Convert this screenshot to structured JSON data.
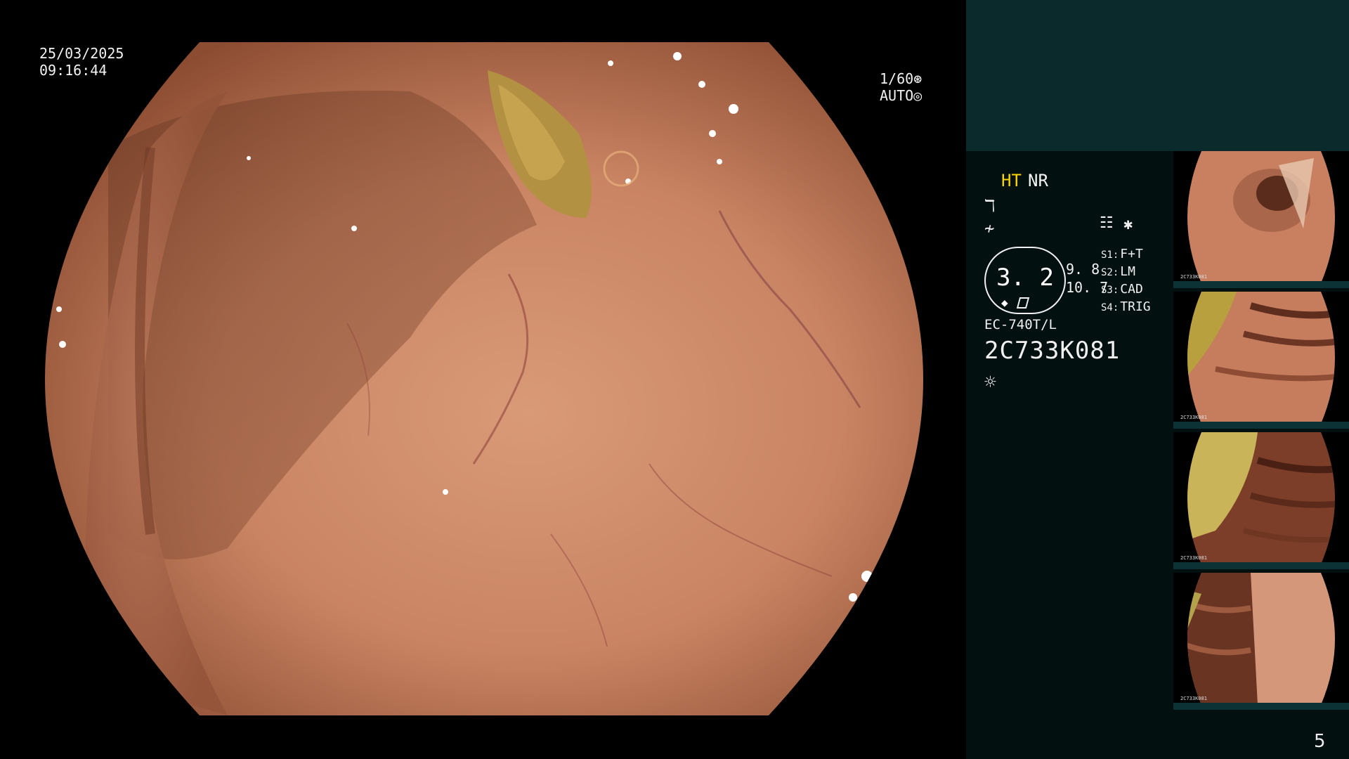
{
  "osd": {
    "date": "25/03/2025",
    "time": "09:16:44",
    "shutter": "1/60",
    "shutter_icon": "aperture-icon",
    "exposure_mode": "AUTO",
    "exposure_icon": "iris-icon"
  },
  "settings": {
    "ht_label": "HT",
    "nr_label": "NR",
    "icon_row1": "contrast-icon",
    "icon_row2": "enhancement-icon",
    "settings_icon": "settings-panel-icon",
    "star_symbol": "✱",
    "gauge_value": "3. 2",
    "gauge_icon": "pen-icon",
    "value_a": "9. 8",
    "value_b": "10. 7",
    "slots": [
      {
        "key": "S1:",
        "value": "F+T"
      },
      {
        "key": "S2:",
        "value": "LM"
      },
      {
        "key": "S3:",
        "value": "CAD"
      },
      {
        "key": "S4:",
        "value": "TRIG"
      }
    ],
    "scope_model": "EC-740T/L",
    "scope_serial": "2C733K081",
    "light_icon": "light-source-icon"
  },
  "thumbnails": [
    {
      "label": "2C733K081"
    },
    {
      "label": "2C733K081"
    },
    {
      "label": "2C733K081"
    },
    {
      "label": "2C733K081"
    }
  ],
  "page_number": "5",
  "colors": {
    "ht_accent": "#ffd400",
    "panel_top": "#0b2a2c",
    "panel_bg": "#02100f",
    "mucosa": "#c98463"
  }
}
